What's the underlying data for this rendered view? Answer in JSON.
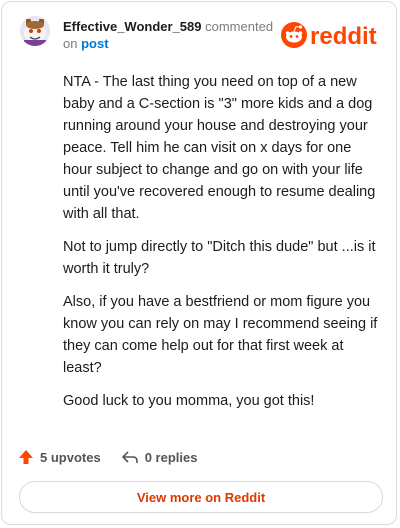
{
  "comment": {
    "author": "Effective_Wonder_589",
    "verb": "commented",
    "on_text": "on",
    "post_link": "post",
    "paragraphs": [
      "NTA - The last thing you need on top of a new baby and a C-section is \"3\" more kids and a dog running around your house and destroying your peace. Tell him he can visit on x days for one hour subject to change and go on with your life until you've recovered enough to resume dealing with all that.",
      "Not to jump directly to \"Ditch this dude\" but ...is it worth it truly?",
      "Also, if you have a bestfriend or mom figure you know you can rely on may I recommend seeing if they can come help out for that first week at least?",
      "Good luck to you momma, you got this!"
    ]
  },
  "brand": {
    "name": "reddit",
    "color": "#ff4500"
  },
  "actions": {
    "upvotes": "5 upvotes",
    "replies": "0 replies"
  },
  "footer": {
    "view_more": "View more on Reddit"
  },
  "icons": {
    "avatar": "snoo-avatar-icon",
    "upvote": "upvote-arrow-icon",
    "reply": "reply-arrow-icon"
  }
}
